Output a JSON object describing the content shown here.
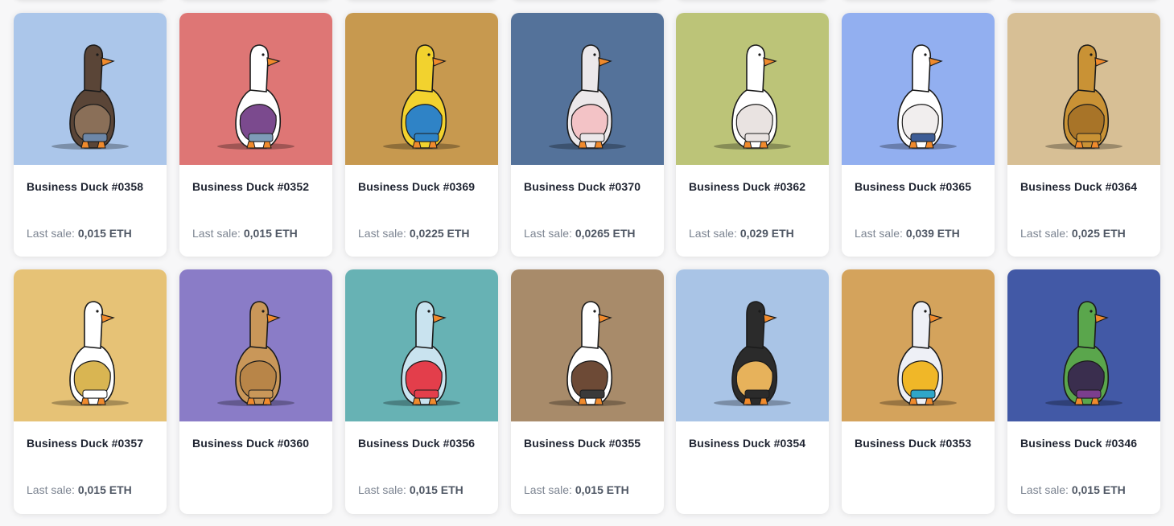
{
  "sale_prefix": "Last sale: ",
  "cards": [
    {
      "name": "Business Duck #0358",
      "sale": "0,015 ETH",
      "bg": "#abc6ea",
      "body": "#5a4537",
      "accent": "#8a6f58",
      "pants": "#6d87a8"
    },
    {
      "name": "Business Duck #0352",
      "sale": "0,015 ETH",
      "bg": "#de7675",
      "body": "#ffffff",
      "accent": "#7b4a8e",
      "pants": "#7e9bb8"
    },
    {
      "name": "Business Duck #0369",
      "sale": "0,0225 ETH",
      "bg": "#c7994f",
      "body": "#f2d22e",
      "accent": "#2f83c6",
      "pants": "#2f83c6"
    },
    {
      "name": "Business Duck #0370",
      "sale": "0,0265 ETH",
      "bg": "#54729a",
      "body": "#ece8ea",
      "accent": "#f3c3c6",
      "pants": "#ece8ea"
    },
    {
      "name": "Business Duck #0362",
      "sale": "0,029 ETH",
      "bg": "#bcc478",
      "body": "#ffffff",
      "accent": "#e9e3e1",
      "pants": "#e9e3e1"
    },
    {
      "name": "Business Duck #0365",
      "sale": "0,039 ETH",
      "bg": "#92aff0",
      "body": "#ffffff",
      "accent": "#f1eeee",
      "pants": "#3d5c95"
    },
    {
      "name": "Business Duck #0364",
      "sale": "0,025 ETH",
      "bg": "#d7bf95",
      "body": "#c99235",
      "accent": "#a87428",
      "pants": "#c99235"
    },
    {
      "name": "Business Duck #0357",
      "sale": "0,015 ETH",
      "bg": "#e6c276",
      "body": "#ffffff",
      "accent": "#d9b552",
      "pants": "#ffffff"
    },
    {
      "name": "Business Duck #0360",
      "sale": "",
      "bg": "#8a7cc7",
      "body": "#c99759",
      "accent": "#b88548",
      "pants": "#c99759"
    },
    {
      "name": "Business Duck #0356",
      "sale": "0,015 ETH",
      "bg": "#67b2b4",
      "body": "#c9e3ef",
      "accent": "#e33e4b",
      "pants": "#e33e4b"
    },
    {
      "name": "Business Duck #0355",
      "sale": "0,015 ETH",
      "bg": "#a88b6a",
      "body": "#ffffff",
      "accent": "#6d4a36",
      "pants": "#3a3a3a"
    },
    {
      "name": "Business Duck #0354",
      "sale": "",
      "bg": "#a9c4e6",
      "body": "#2b2b2b",
      "accent": "#e7b25b",
      "pants": "#2b2b2b"
    },
    {
      "name": "Business Duck #0353",
      "sale": "",
      "bg": "#d4a35c",
      "body": "#eef0f6",
      "accent": "#f0b728",
      "pants": "#2fa6c9"
    },
    {
      "name": "Business Duck #0346",
      "sale": "0,015 ETH",
      "bg": "#4259a6",
      "body": "#5aa64c",
      "accent": "#3a2e4e",
      "pants": "#7b3e8e"
    }
  ]
}
